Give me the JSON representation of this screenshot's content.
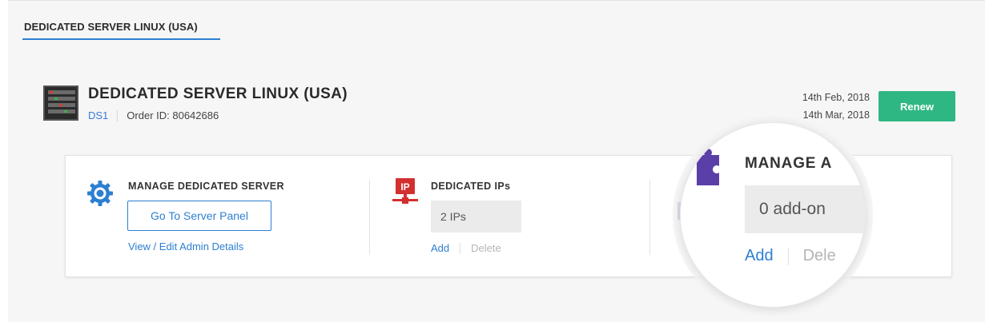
{
  "tab": {
    "label": "DEDICATED SERVER LINUX (USA)"
  },
  "server": {
    "title": "DEDICATED SERVER LINUX (USA)",
    "code": "DS1",
    "order_id": "Order ID: 80642686",
    "start_date": "14th Feb, 2018",
    "end_date": "14th Mar, 2018",
    "renew_label": "Renew"
  },
  "manage_server": {
    "title": "MANAGE DEDICATED SERVER",
    "panel_button": "Go To Server Panel",
    "admin_link": "View / Edit Admin Details",
    "icon": "gear-icon"
  },
  "dedicated_ips": {
    "title": "DEDICATED IPs",
    "icon_text": "IP",
    "value": "2 IPs",
    "add_label": "Add",
    "delete_label": "Delete"
  },
  "addons": {
    "title": "MANAGE A",
    "value": "0 add-on",
    "add_label": "Add",
    "delete_label": "Dele",
    "icon": "puzzle-icon"
  },
  "colors": {
    "accent": "#2d7fd1",
    "renew": "#2fb783",
    "puzzle": "#5b3fa8",
    "ip_red": "#d32f2f"
  }
}
